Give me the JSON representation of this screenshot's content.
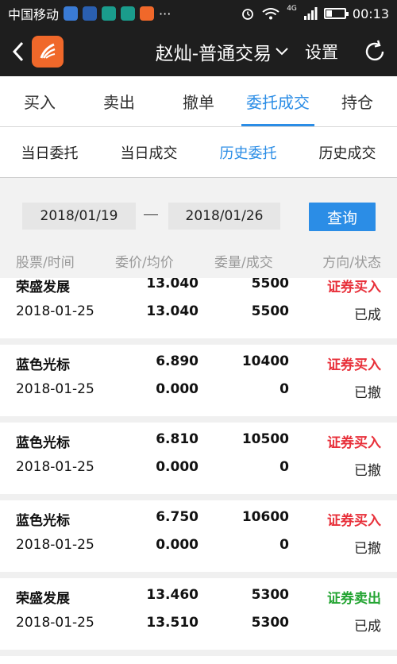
{
  "status_bar": {
    "carrier": "中国移动",
    "dots": "···",
    "network": "4G",
    "time": "00:13"
  },
  "navbar": {
    "title": "赵灿-普通交易",
    "settings_label": "设置"
  },
  "tabs": [
    {
      "label": "买入",
      "active": false
    },
    {
      "label": "卖出",
      "active": false
    },
    {
      "label": "撤单",
      "active": false
    },
    {
      "label": "委托成交",
      "active": true
    },
    {
      "label": "持仓",
      "active": false
    }
  ],
  "subtabs": [
    {
      "label": "当日委托",
      "active": false
    },
    {
      "label": "当日成交",
      "active": false
    },
    {
      "label": "历史委托",
      "active": true
    },
    {
      "label": "历史成交",
      "active": false
    }
  ],
  "query": {
    "date_from": "2018/01/19",
    "date_to": "2018/01/26",
    "button_label": "查询"
  },
  "columns": [
    "股票/时间",
    "委价/均价",
    "委量/成交",
    "方向/状态"
  ],
  "orders": [
    {
      "name": "荣盛发展",
      "date": "2018-01-25",
      "order_price": "13.040",
      "avg_price": "13.040",
      "order_qty": "5500",
      "filled_qty": "5500",
      "direction": "证券买入",
      "status": "已成",
      "dir_type": "buy"
    },
    {
      "name": "蓝色光标",
      "date": "2018-01-25",
      "order_price": "6.890",
      "avg_price": "0.000",
      "order_qty": "10400",
      "filled_qty": "0",
      "direction": "证券买入",
      "status": "已撤",
      "dir_type": "buy"
    },
    {
      "name": "蓝色光标",
      "date": "2018-01-25",
      "order_price": "6.810",
      "avg_price": "0.000",
      "order_qty": "10500",
      "filled_qty": "0",
      "direction": "证券买入",
      "status": "已撤",
      "dir_type": "buy"
    },
    {
      "name": "蓝色光标",
      "date": "2018-01-25",
      "order_price": "6.750",
      "avg_price": "0.000",
      "order_qty": "10600",
      "filled_qty": "0",
      "direction": "证券买入",
      "status": "已撤",
      "dir_type": "buy"
    },
    {
      "name": "荣盛发展",
      "date": "2018-01-25",
      "order_price": "13.460",
      "avg_price": "13.510",
      "order_qty": "5300",
      "filled_qty": "5300",
      "direction": "证券卖出",
      "status": "已成",
      "dir_type": "sell"
    }
  ],
  "colors": {
    "accent": "#2b8de6",
    "buy": "#e8303a",
    "sell": "#23a432",
    "logo": "#f0682a"
  },
  "battery_level": 0.3
}
